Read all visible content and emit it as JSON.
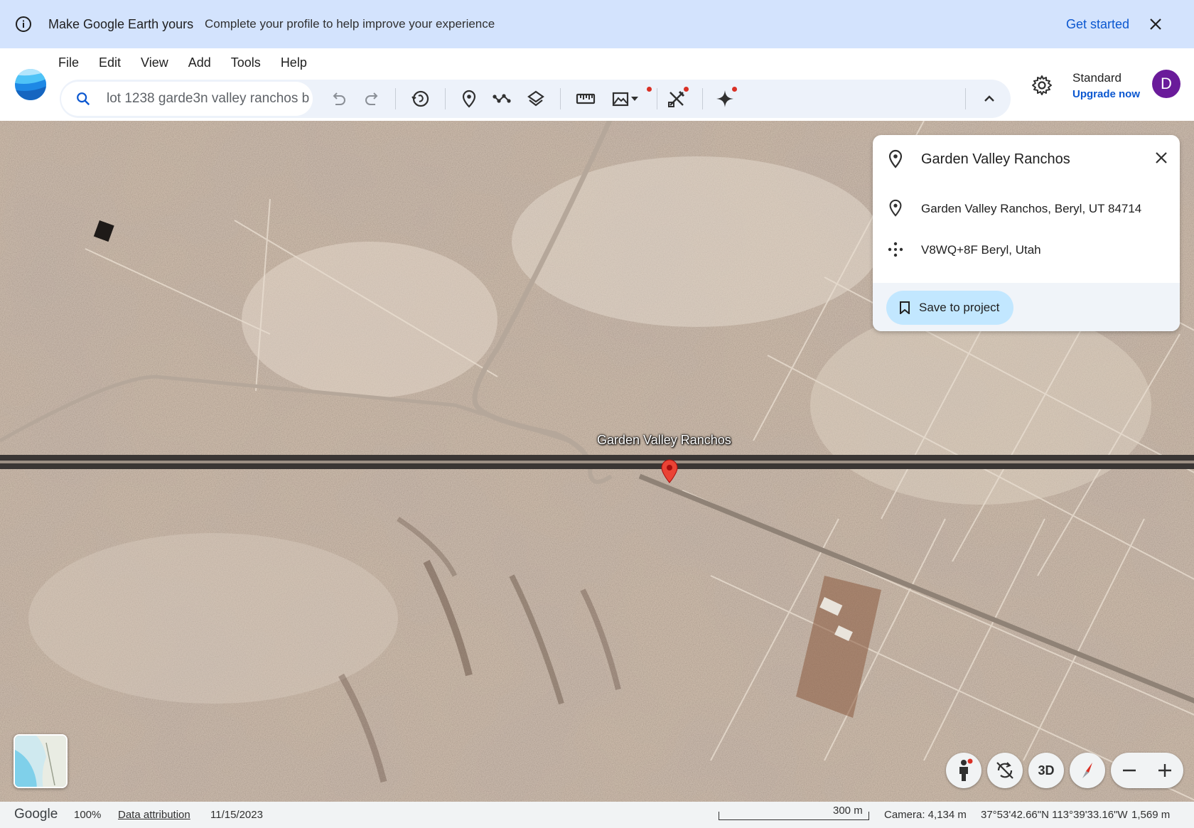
{
  "banner": {
    "title": "Make Google Earth yours",
    "message": "Complete your profile to help improve your experience",
    "cta": "Get started"
  },
  "menu": [
    "File",
    "Edit",
    "View",
    "Add",
    "Tools",
    "Help"
  ],
  "search": {
    "value": "lot 1238 garde3n valley ranchos b"
  },
  "toolbar": {
    "icons": [
      "undo-icon",
      "redo-icon",
      "history-icon",
      "placemark-icon",
      "path-icon",
      "layers-icon",
      "ruler-icon",
      "map-style-icon",
      "tools-icon",
      "ai-sparkle-icon",
      "collapse-icon"
    ]
  },
  "account": {
    "plan": "Standard",
    "upgrade": "Upgrade now",
    "avatar_letter": "D"
  },
  "map": {
    "label": "Garden Valley Ranchos"
  },
  "card": {
    "title": "Garden Valley Ranchos",
    "address": "Garden Valley Ranchos, Beryl, UT 84714",
    "plus_code": "V8WQ+8F Beryl, Utah",
    "save_label": "Save to project"
  },
  "controls": {
    "three_d": "3D"
  },
  "status": {
    "brand": "Google",
    "zoom": "100%",
    "attribution": "Data attribution",
    "date": "11/15/2023",
    "scale": "300 m",
    "camera": "Camera: 4,134 m",
    "coords": "37°53'42.66\"N 113°39'33.16\"W",
    "elevation": "1,569 m"
  },
  "colors": {
    "banner_bg": "#d3e3fd",
    "accent": "#0b57d0",
    "avatar": "#6a1b9a",
    "pin": "#ea4335",
    "save_bg": "#c2e7ff"
  }
}
